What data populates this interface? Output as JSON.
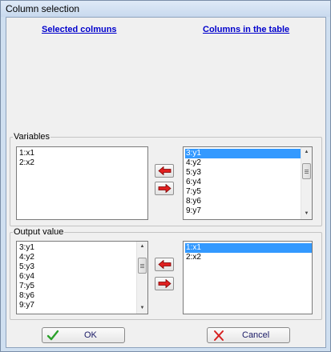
{
  "window": {
    "title": "Column selection"
  },
  "headers": {
    "selected": "Selected colmuns",
    "table": "Columns in the table"
  },
  "variables": {
    "label": "Variables",
    "selected_items": [
      "1:x1",
      "2:x2"
    ],
    "table_items": [
      "3:y1",
      "4:y2",
      "5:y3",
      "6:y4",
      "7:y5",
      "8:y6",
      "9:y7"
    ],
    "table_highlighted": "3:y1"
  },
  "output": {
    "label": "Output value",
    "selected_items": [
      "3:y1",
      "4:y2",
      "5:y3",
      "6:y4",
      "7:y5",
      "8:y6",
      "9:y7"
    ],
    "table_items": [
      "1:x1",
      "2:x2"
    ],
    "table_highlighted": "1:x1"
  },
  "buttons": {
    "ok": "OK",
    "cancel": "Cancel"
  },
  "icons": {
    "move_left": "red-arrow-left-icon",
    "move_right": "red-arrow-right-icon",
    "ok": "green-check-icon",
    "cancel": "red-x-icon"
  },
  "colors": {
    "arrow": "#e02020",
    "highlight": "#3399ff",
    "link": "#0000cc",
    "check": "#2aa12a",
    "cross": "#d62020"
  }
}
